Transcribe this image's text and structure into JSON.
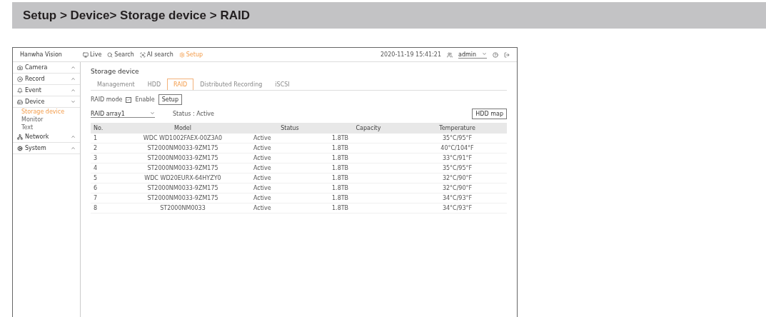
{
  "heading": "Setup > Device> Storage device > RAID",
  "app": {
    "logo": "Hanwha Vision",
    "nav": [
      {
        "label": "Live",
        "selected": false
      },
      {
        "label": "Search",
        "selected": false
      },
      {
        "label": "AI search",
        "selected": false
      },
      {
        "label": "Setup",
        "selected": true
      }
    ],
    "datetime": "2020-11-19 15:41:21",
    "user": "admin",
    "sidebar": [
      {
        "label": "Camera",
        "expanded": false
      },
      {
        "label": "Record",
        "expanded": false
      },
      {
        "label": "Event",
        "expanded": false
      },
      {
        "label": "Device",
        "expanded": true,
        "children": [
          {
            "label": "Storage device",
            "selected": true
          },
          {
            "label": "Monitor",
            "selected": false
          },
          {
            "label": "Text",
            "selected": false
          }
        ]
      },
      {
        "label": "Network",
        "expanded": false
      },
      {
        "label": "System",
        "expanded": false
      }
    ],
    "page_title": "Storage device",
    "tabs": [
      {
        "label": "Management",
        "selected": false
      },
      {
        "label": "HDD",
        "selected": false
      },
      {
        "label": "RAID",
        "selected": true
      },
      {
        "label": "Distributed Recording",
        "selected": false
      },
      {
        "label": "iSCSI",
        "selected": false
      }
    ],
    "raid_mode": {
      "label": "RAID mode",
      "checkbox_label": "Enable",
      "checked": true,
      "button": "Setup"
    },
    "array_select": "RAID array1",
    "status": "Status : Active",
    "map_button": "HDD map",
    "table": {
      "columns": [
        "No.",
        "Model",
        "Status",
        "Capacity",
        "Temperature"
      ],
      "rows": [
        [
          "1",
          "WDC WD1002FAEX-00Z3A0",
          "Active",
          "1.8TB",
          "35°C/95°F"
        ],
        [
          "2",
          "ST2000NM0033-9ZM175",
          "Active",
          "1.8TB",
          "40°C/104°F"
        ],
        [
          "3",
          "ST2000NM0033-9ZM175",
          "Active",
          "1.8TB",
          "33°C/91°F"
        ],
        [
          "4",
          "ST2000NM0033-9ZM175",
          "Active",
          "1.8TB",
          "35°C/95°F"
        ],
        [
          "5",
          "WDC WD20EURX-64HYZY0",
          "Active",
          "1.8TB",
          "32°C/90°F"
        ],
        [
          "6",
          "ST2000NM0033-9ZM175",
          "Active",
          "1.8TB",
          "32°C/90°F"
        ],
        [
          "7",
          "ST2000NM0033-9ZM175",
          "Active",
          "1.8TB",
          "34°C/93°F"
        ],
        [
          "8",
          "ST2000NM0033",
          "Active",
          "1.8TB",
          "34°C/93°F"
        ]
      ]
    }
  }
}
